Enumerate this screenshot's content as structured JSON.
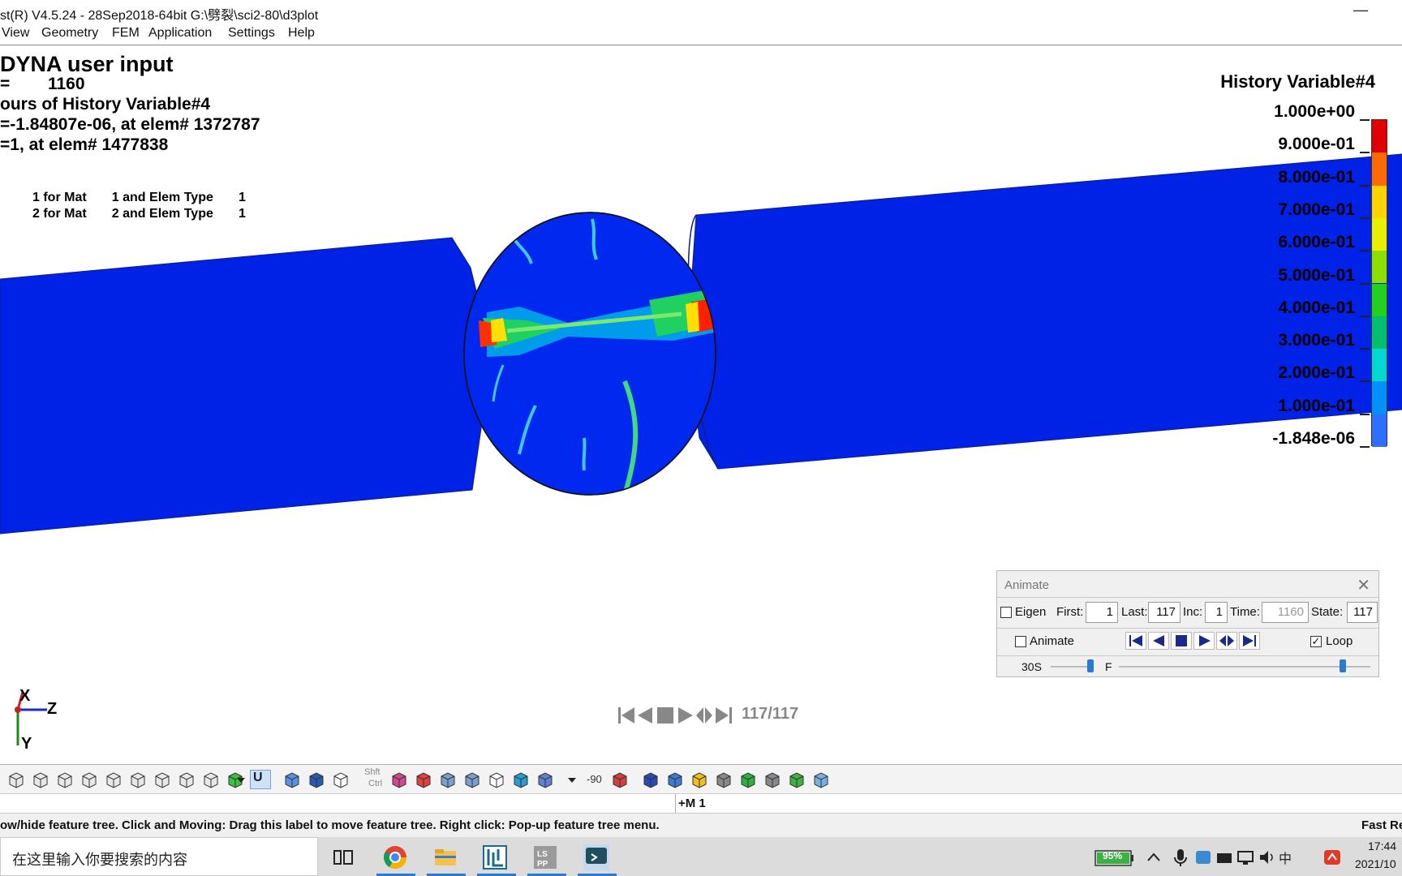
{
  "window": {
    "title": "st(R) V4.5.24 - 28Sep2018-64bit G:\\劈裂\\sci2-80\\d3plot",
    "minimize": "—"
  },
  "menu": [
    "View",
    "Geometry",
    "FEM",
    "Application",
    "Settings",
    "Help"
  ],
  "header": {
    "line1": "DYNA user input",
    "line2": "=        1160",
    "line3": "ours of History Variable#4",
    "line4": "=-1.84807e-06, at elem# 1372787",
    "line5": "=1, at elem# 1477838",
    "mat1": "1 for Mat       1 and Elem Type       1",
    "mat2": "2 for Mat       2 and Elem Type       1"
  },
  "legend": {
    "title": "History Variable#4",
    "labels": [
      "1.000e+00",
      "9.000e-01",
      "8.000e-01",
      "7.000e-01",
      "6.000e-01",
      "5.000e-01",
      "4.000e-01",
      "3.000e-01",
      "2.000e-01",
      "1.000e-01",
      "-1.848e-06"
    ],
    "colors": [
      "#e00000",
      "#ff6a00",
      "#ffd200",
      "#e8f000",
      "#8ce000",
      "#22d020",
      "#00c070",
      "#00d8d0",
      "#0090ff",
      "#2f6fff",
      "#0018e0"
    ]
  },
  "axes": {
    "x": "X",
    "y": "Y",
    "z": "Z"
  },
  "animate": {
    "title": "Animate",
    "close": "✕",
    "eigen": "Eigen",
    "eigen_checked": "",
    "first_label": "First:",
    "first": "1",
    "last_label": "Last:",
    "last": "117",
    "inc_label": "Inc:",
    "inc": "1",
    "time_label": "Time:",
    "time": "1160",
    "state_label": "State:",
    "state": "117",
    "animate_label": "Animate",
    "animate_checked": "",
    "loop_label": "Loop",
    "loop_checked": "✓",
    "speed_label": "30S",
    "speed_mark": "F"
  },
  "frame_status": "117/117",
  "toolbar": {
    "shift": "Shft",
    "ctrl": "Ctrl",
    "rot": "-90",
    "mode": "U"
  },
  "command_row": "+M 1",
  "hint_row": "ow/hide feature tree. Click and Moving: Drag this label to move feature tree. Right click: Pop-up feature tree menu.",
  "hint_right": "Fast Re",
  "taskbar": {
    "search_placeholder": "在这里输入你要搜索的内容",
    "battery": "95%",
    "ime": "中",
    "time": "17:44",
    "date": "2021/10"
  }
}
